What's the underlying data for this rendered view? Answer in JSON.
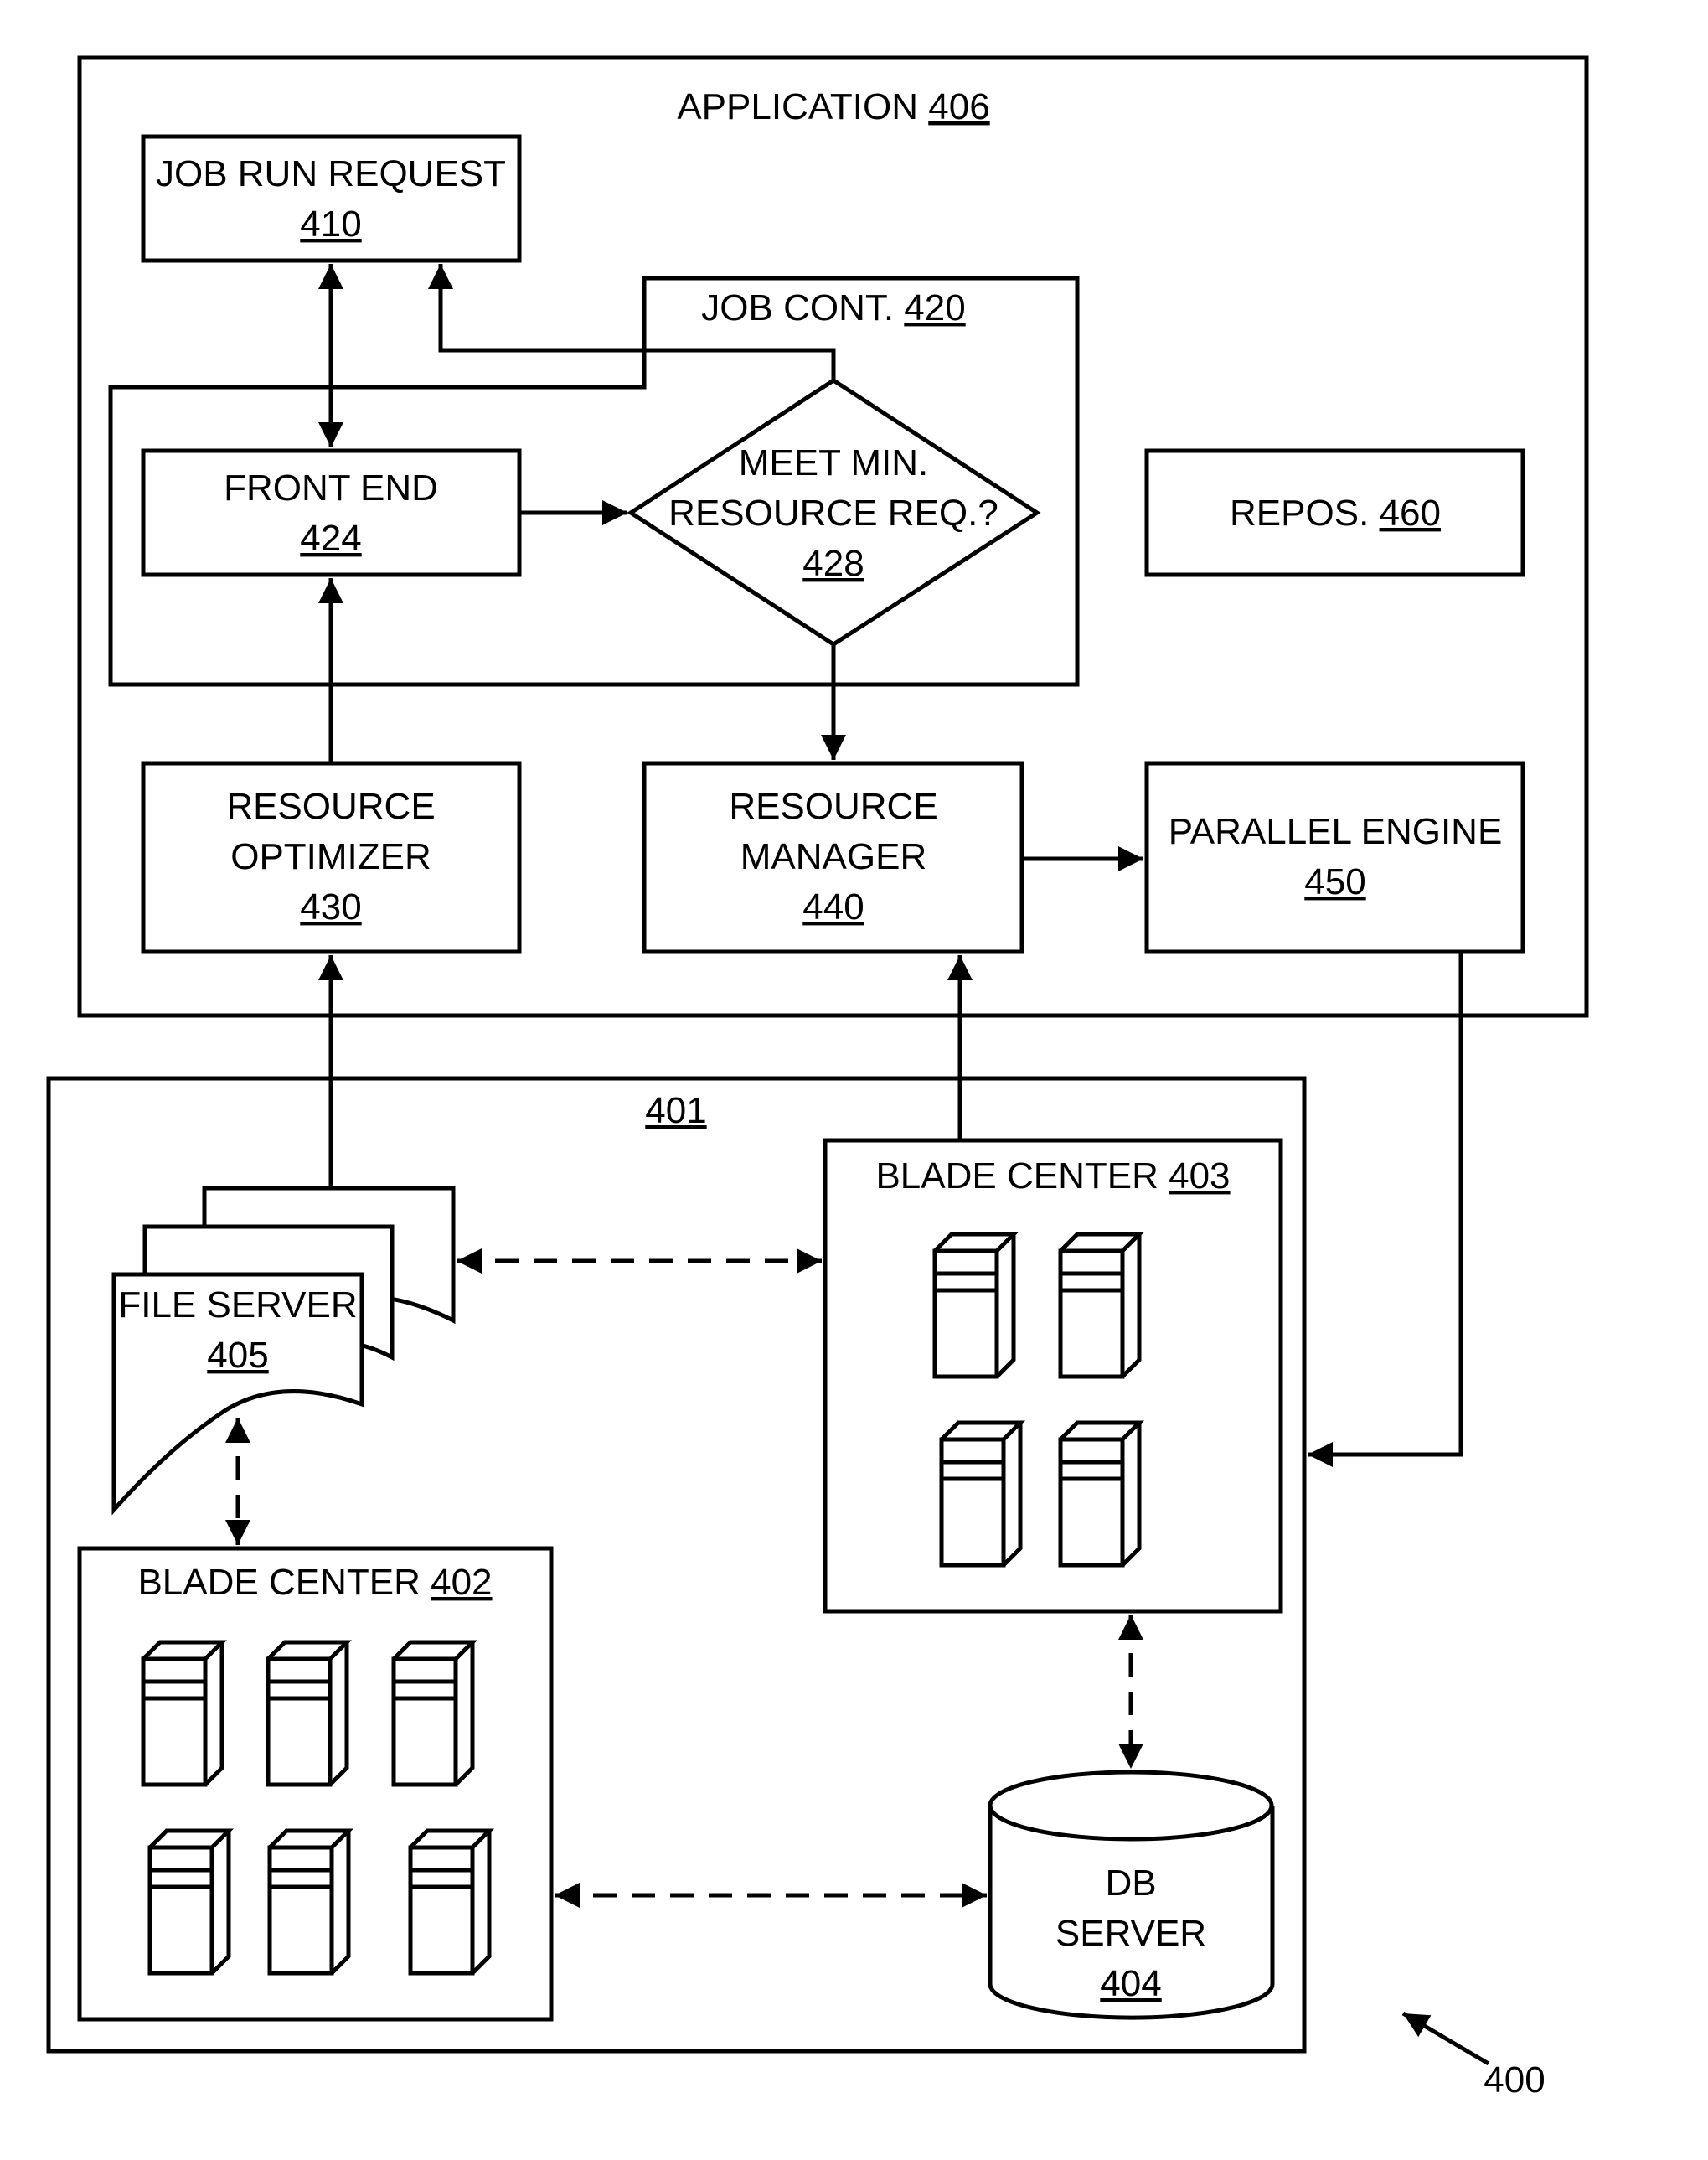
{
  "figure_number": "400",
  "application": {
    "label": "APPLICATION",
    "ref": "406"
  },
  "job_run_request": {
    "label": "JOB RUN REQUEST",
    "ref": "410"
  },
  "job_cont": {
    "label": "JOB CONT.",
    "ref": "420"
  },
  "front_end": {
    "label": "FRONT END",
    "ref": "424"
  },
  "decision": {
    "line1": "MEET MIN.",
    "line2": "RESOURCE REQ.?",
    "ref": "428"
  },
  "repos": {
    "label": "REPOS.",
    "ref": "460"
  },
  "resource_optimizer": {
    "line1": "RESOURCE",
    "line2": "OPTIMIZER",
    "ref": "430"
  },
  "resource_manager": {
    "line1": "RESOURCE",
    "line2": "MANAGER",
    "ref": "440"
  },
  "parallel_engine": {
    "label": "PARALLEL ENGINE",
    "ref": "450"
  },
  "cluster": {
    "ref": "401"
  },
  "file_server": {
    "label": "FILE SERVER",
    "ref": "405"
  },
  "blade_center_403": {
    "label": "BLADE CENTER",
    "ref": "403",
    "server_count": 4
  },
  "blade_center_402": {
    "label": "BLADE CENTER",
    "ref": "402",
    "server_count": 6
  },
  "db_server": {
    "line1": "DB",
    "line2": "SERVER",
    "ref": "404"
  }
}
